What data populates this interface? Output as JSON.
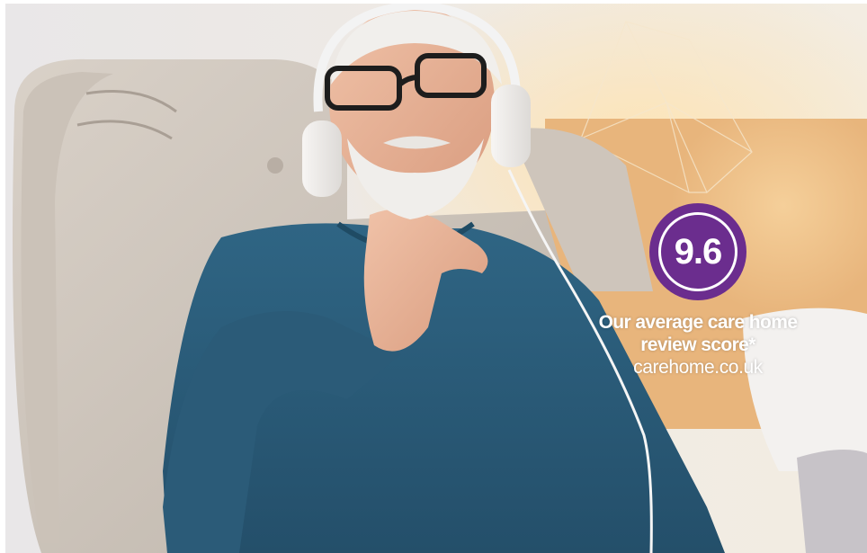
{
  "badge": {
    "score": "9.6",
    "color": "#6b2d8e"
  },
  "caption": {
    "line1": "Our average care home",
    "line2": "review score*",
    "source": "carehome.co.uk"
  }
}
